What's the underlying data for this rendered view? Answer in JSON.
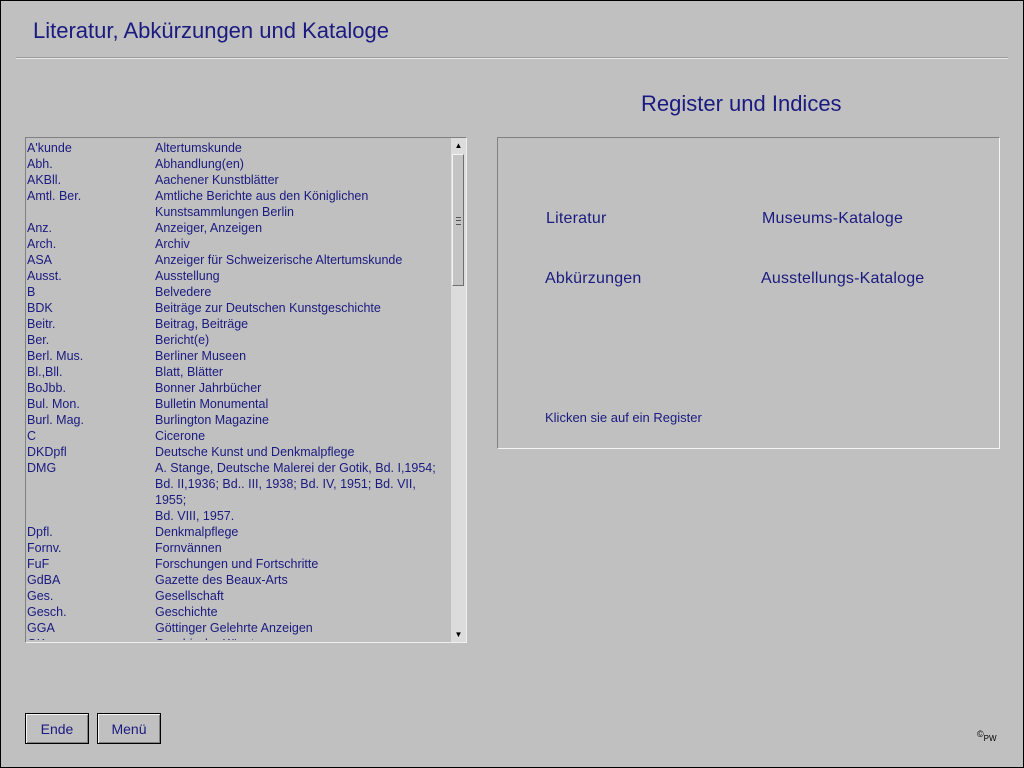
{
  "window": {
    "title": "Literatur, Abkürzungen und Kataloge"
  },
  "register": {
    "title": "Register und Indices",
    "links": {
      "literatur": "Literatur",
      "museums_kataloge": "Museums-Kataloge",
      "abkuerzungen": "Abkürzungen",
      "ausstellungs_kataloge": "Ausstellungs-Kataloge"
    },
    "hint": "Klicken sie auf ein Register"
  },
  "abbreviations": [
    {
      "abbr": "A'kunde",
      "expansion": "Altertumskunde"
    },
    {
      "abbr": "Abh.",
      "expansion": "Abhandlung(en)"
    },
    {
      "abbr": "AKBll.",
      "expansion": "Aachener Kunstblätter"
    },
    {
      "abbr": "Amtl. Ber.",
      "expansion": "Amtliche Berichte aus den Königlichen"
    },
    {
      "abbr": "",
      "expansion": "Kunstsammlungen Berlin"
    },
    {
      "abbr": "Anz.",
      "expansion": "Anzeiger, Anzeigen"
    },
    {
      "abbr": "Arch.",
      "expansion": "Archiv"
    },
    {
      "abbr": "ASA",
      "expansion": "Anzeiger für Schweizerische Altertumskunde"
    },
    {
      "abbr": "Ausst.",
      "expansion": "Ausstellung"
    },
    {
      "abbr": "B",
      "expansion": "Belvedere"
    },
    {
      "abbr": "BDK",
      "expansion": "Beiträge zur Deutschen Kunstgeschichte"
    },
    {
      "abbr": "Beitr.",
      "expansion": "Beitrag, Beiträge"
    },
    {
      "abbr": "Ber.",
      "expansion": "Bericht(e)"
    },
    {
      "abbr": "Berl. Mus.",
      "expansion": "Berliner Museen"
    },
    {
      "abbr": "Bl.,Bll.",
      "expansion": "Blatt, Blätter"
    },
    {
      "abbr": "BoJbb.",
      "expansion": "Bonner Jahrbücher"
    },
    {
      "abbr": "Bul. Mon.",
      "expansion": "Bulletin Monumental"
    },
    {
      "abbr": "Burl. Mag.",
      "expansion": "Burlington Magazine"
    },
    {
      "abbr": "C",
      "expansion": "Cicerone"
    },
    {
      "abbr": "DKDpfl",
      "expansion": "Deutsche Kunst und Denkmalpflege"
    },
    {
      "abbr": "DMG",
      "expansion": "A. Stange, Deutsche Malerei der Gotik, Bd. I,1954;"
    },
    {
      "abbr": "",
      "expansion": "Bd. II,1936; Bd.. III, 1938; Bd. IV, 1951; Bd. VII, 1955;"
    },
    {
      "abbr": "",
      "expansion": "Bd. VIII, 1957."
    },
    {
      "abbr": "Dpfl.",
      "expansion": "Denkmalpflege"
    },
    {
      "abbr": "Fornv.",
      "expansion": "Fornvännen"
    },
    {
      "abbr": "FuF",
      "expansion": "Forschungen und Fortschritte"
    },
    {
      "abbr": "GdBA",
      "expansion": "Gazette des Beaux-Arts"
    },
    {
      "abbr": "Ges.",
      "expansion": "Gesellschaft"
    },
    {
      "abbr": "Gesch.",
      "expansion": "Geschichte"
    },
    {
      "abbr": "GGA",
      "expansion": "Göttinger Gelehrte Anzeigen"
    },
    {
      "abbr": "GK",
      "expansion": "Graphische Künste"
    }
  ],
  "buttons": {
    "end": "Ende",
    "menu": "Menü"
  },
  "copyright": {
    "symbol": "©",
    "initials": "PW"
  }
}
